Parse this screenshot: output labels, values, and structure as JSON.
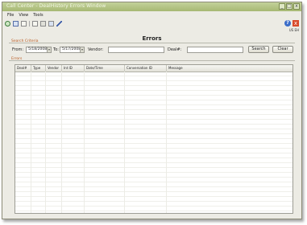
{
  "window": {
    "title": "Call Center - DealHistory Errors Window",
    "controls": [
      "_",
      "□",
      "x"
    ]
  },
  "menu": [
    "File",
    "View",
    "Tools"
  ],
  "toolbar_icons": [
    "refresh-icon",
    "save-icon",
    "print-icon",
    "copy-icon",
    "settings-icon",
    "filter-icon",
    "edit-icon"
  ],
  "top_right": {
    "help": "?",
    "close": "x",
    "language": "US EH"
  },
  "page_title": "Errors",
  "search": {
    "section_label": "Search Criteria",
    "from_label": "From:",
    "from_value": "5/18/2008",
    "to_label": "To:",
    "to_value": "5/17/2008",
    "vendor_label": "Vendor:",
    "vendor_value": "",
    "deal_label": "Deal#:",
    "deal_value": "",
    "search_button": "Search",
    "clear_button": "Clear"
  },
  "errors_section_label": "Errors",
  "table": {
    "columns": [
      "Deal#",
      "Type",
      "Vendor",
      "Int ID",
      "Date/Time",
      "Conversation ID",
      "Message"
    ]
  },
  "colors": {
    "section_label": "#b85820",
    "titlebar": "#a6b872"
  }
}
